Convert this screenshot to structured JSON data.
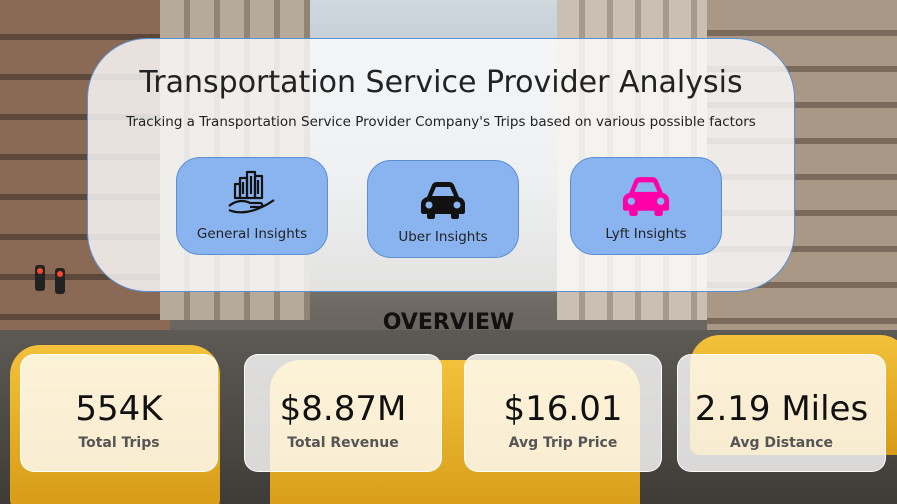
{
  "header": {
    "title": "Transportation Service Provider Analysis",
    "subtitle": "Tracking a Transportation Service Provider Company's Trips based on various possible factors"
  },
  "nav": [
    {
      "label": "General Insights",
      "icon": "city-hand-icon",
      "icon_color": "#111111"
    },
    {
      "label": "Uber Insights",
      "icon": "car-icon",
      "icon_color": "#111111"
    },
    {
      "label": "Lyft Insights",
      "icon": "car-icon",
      "icon_color": "#ff00a8"
    }
  ],
  "overview": {
    "title": "OVERVIEW",
    "kpis": [
      {
        "value": "554K",
        "label": "Total Trips"
      },
      {
        "value": "$8.87M",
        "label": "Total Revenue"
      },
      {
        "value": "$16.01",
        "label": "Avg Trip Price"
      },
      {
        "value": "2.19 Miles",
        "label": "Avg Distance"
      }
    ]
  },
  "colors": {
    "button_fill": "#8ab4f0",
    "button_border": "#5b8fd0",
    "lyft_accent": "#ff00a8"
  }
}
